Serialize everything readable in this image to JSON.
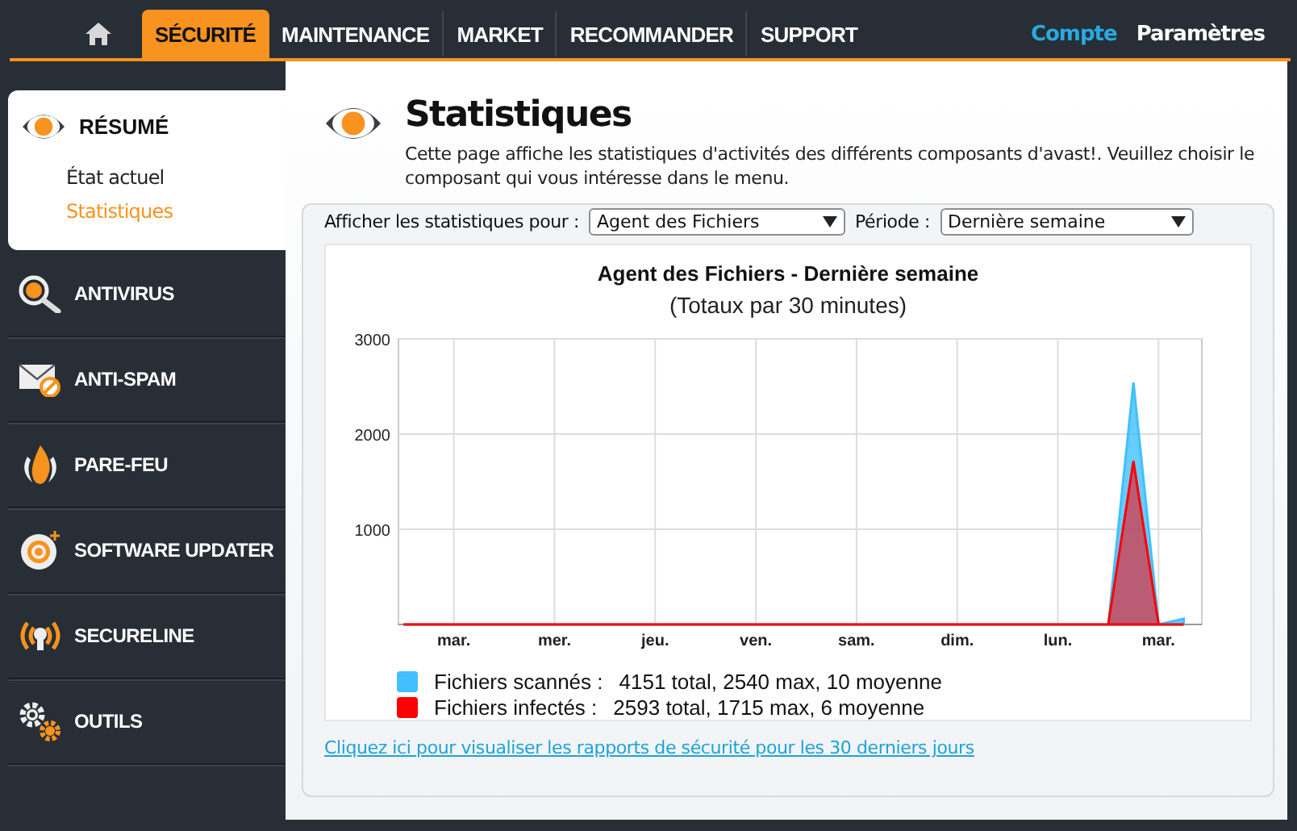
{
  "top_nav": {
    "tabs": [
      {
        "label": "SÉCURITÉ",
        "selected": true
      },
      {
        "label": "MAINTENANCE",
        "selected": false
      },
      {
        "label": "MARKET",
        "selected": false
      },
      {
        "label": "RECOMMANDER",
        "selected": false
      },
      {
        "label": "SUPPORT",
        "selected": false
      }
    ],
    "links": [
      {
        "label": "Compte",
        "kind": "highlight"
      },
      {
        "label": "Paramètres",
        "kind": "plain"
      }
    ]
  },
  "sidebar": {
    "summary": {
      "label": "RÉSUMÉ",
      "expanded": true,
      "children": [
        {
          "label": "État actuel",
          "selected": false
        },
        {
          "label": "Statistiques",
          "selected": true
        }
      ]
    },
    "items": [
      {
        "label": "ANTIVIRUS"
      },
      {
        "label": "ANTI-SPAM"
      },
      {
        "label": "PARE-FEU"
      },
      {
        "label": "SOFTWARE UPDATER"
      },
      {
        "label": "SECURELINE"
      },
      {
        "label": "OUTILS"
      }
    ]
  },
  "page": {
    "title": "Statistiques",
    "description": "Cette page affiche les statistiques d'activités des différents composants d'avast!. Veuillez choisir le composant qui vous intéresse dans le menu.",
    "filters": [
      {
        "label": "Afficher les statistiques pour :",
        "value": "Agent des Fichiers"
      },
      {
        "label": "Période :",
        "value": "Dernière semaine"
      }
    ],
    "chart": {
      "subtitle": "(Totaux par 30 minutes)",
      "chart_data": {
        "type": "area",
        "grid": true,
        "title": "Agent des Fichiers - Dernière semaine",
        "ylim": [
          0,
          3000
        ],
        "yticks": [
          1000,
          2000,
          3000
        ],
        "categories": [
          null,
          null,
          "mar.",
          null,
          null,
          null,
          "mer.",
          null,
          null,
          null,
          "jeu.",
          null,
          null,
          null,
          "ven.",
          null,
          null,
          null,
          "sam.",
          null,
          null,
          null,
          "dim.",
          null,
          null,
          null,
          "lun.",
          null,
          null,
          null,
          "mar.",
          null
        ],
        "series": [
          {
            "name": "Fichiers scannés",
            "color": "#40c0ff",
            "values": [
              0,
              0,
              0,
              0,
              0,
              0,
              0,
              0,
              0,
              0,
              0,
              0,
              0,
              0,
              0,
              0,
              0,
              0,
              0,
              0,
              0,
              0,
              0,
              0,
              0,
              0,
              0,
              0,
              0,
              2540,
              0,
              60
            ]
          },
          {
            "name": "Fichiers infectés",
            "color": "#ff0000",
            "values": [
              0,
              0,
              0,
              0,
              0,
              0,
              0,
              0,
              0,
              0,
              0,
              0,
              0,
              0,
              0,
              0,
              0,
              0,
              0,
              0,
              0,
              0,
              0,
              0,
              0,
              0,
              0,
              0,
              0,
              1715,
              0,
              0
            ]
          }
        ]
      },
      "legend": [
        {
          "suffix": ":",
          "stats": "4151 total, 2540 max, 10 moyenne"
        },
        {
          "suffix": ":",
          "stats": "2593 total, 1715 max, 6 moyenne"
        }
      ]
    },
    "link": "Cliquez ici pour visualiser les rapports de sécurité pour les 30 derniers jours"
  }
}
